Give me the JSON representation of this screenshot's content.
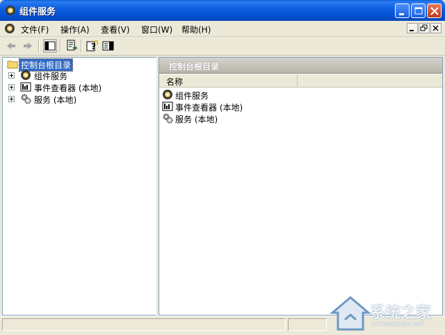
{
  "window": {
    "title": "组件服务"
  },
  "menubar": {
    "items": [
      {
        "label": "文件(F)"
      },
      {
        "label": "操作(A)"
      },
      {
        "label": "查看(V)"
      },
      {
        "label": "窗口(W)"
      },
      {
        "label": "帮助(H)"
      }
    ]
  },
  "toolbar": {
    "buttons": [
      "back-arrow-icon",
      "forward-arrow-icon",
      "show-hide-tree-icon",
      "export-list-icon",
      "help-icon",
      "show-hide-action-pane-icon"
    ]
  },
  "tree": {
    "root": "控制台根目录",
    "items": [
      {
        "label": "组件服务",
        "icon": "component-services-icon"
      },
      {
        "label": "事件查看器 (本地)",
        "icon": "event-viewer-icon"
      },
      {
        "label": "服务 (本地)",
        "icon": "services-gear-icon"
      }
    ]
  },
  "right_pane": {
    "header": "控制台根目录",
    "columns": [
      "名称"
    ],
    "items": [
      {
        "label": "组件服务",
        "icon": "component-services-icon"
      },
      {
        "label": "事件查看器 (本地)",
        "icon": "event-viewer-icon"
      },
      {
        "label": "服务 (本地)",
        "icon": "services-gear-icon"
      }
    ]
  },
  "watermark": {
    "text": "系统之家",
    "url": "XITONGZHIJIA.NET"
  },
  "colors": {
    "titlebar": "#0553d6",
    "selection": "#316ac5",
    "header": "#b8b4a8"
  }
}
